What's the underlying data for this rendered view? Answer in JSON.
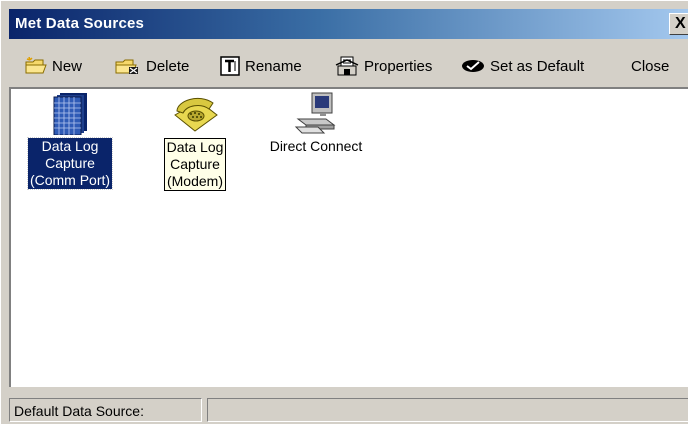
{
  "window": {
    "title": "Met Data Sources",
    "close_glyph": "X"
  },
  "toolbar": {
    "new": "New",
    "delete": "Delete",
    "rename": "Rename",
    "properties": "Properties",
    "set_default": "Set as Default",
    "close": "Close"
  },
  "items": [
    {
      "label": "Data Log\nCapture\n(Comm Port)",
      "icon": "grid-document-icon",
      "state": "selected"
    },
    {
      "label": "Data Log\nCapture\n(Modem)",
      "icon": "telephone-icon",
      "state": "focused"
    },
    {
      "label": "Direct Connect",
      "icon": "computer-icon",
      "state": "normal"
    }
  ],
  "status": {
    "label": "Default Data Source:",
    "value": ""
  },
  "colors": {
    "title_start": "#0a246a",
    "title_end": "#a6caf0",
    "selection": "#0a246a",
    "face": "#d4d0c8"
  }
}
